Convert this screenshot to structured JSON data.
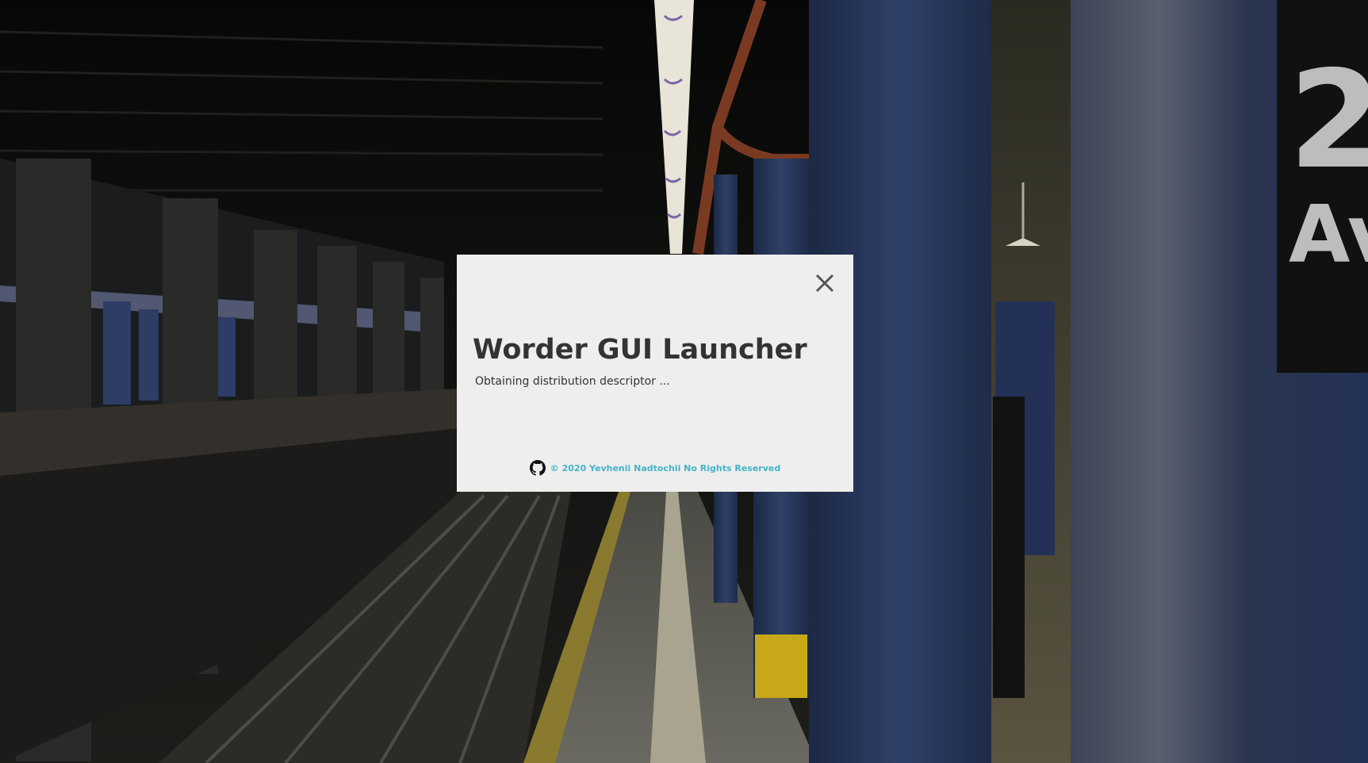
{
  "dialog": {
    "title": "Worder GUI Launcher",
    "status": "Obtaining distribution descriptor ...",
    "close_icon": "close-icon",
    "footer": {
      "icon": "github-icon",
      "text": "© 2020 Yevhenii Nadtochii No Rights Reserved",
      "color": "#44b4c8"
    },
    "background_color": "#eeeeee"
  },
  "background": {
    "description_icon": "subway-station-photo",
    "sign_text": "2 Av"
  }
}
